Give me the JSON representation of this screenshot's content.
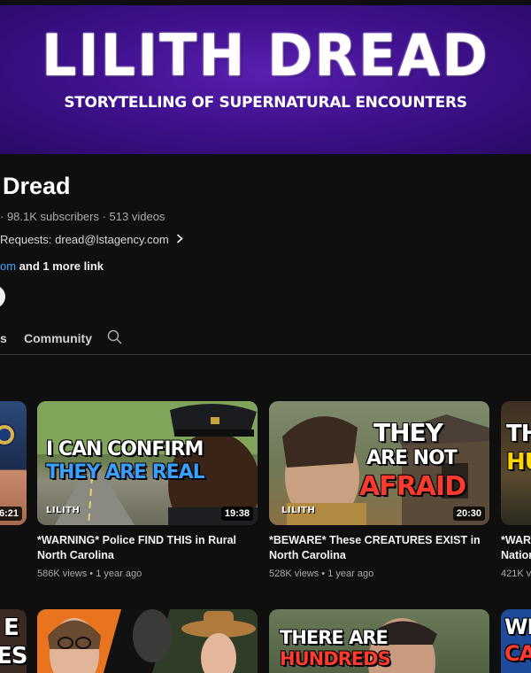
{
  "banner": {
    "title": "LILITH DREAD",
    "tagline": "STORYTELLING OF SUPERNATURAL ENCOUNTERS"
  },
  "channel": {
    "name": "Dread",
    "meta": "· 98.1K subscribers · 513 videos",
    "description": "Requests: dread@lstagency.com",
    "link_partial": "om",
    "more_links": " and 1 more link"
  },
  "tabs": {
    "partial": "s",
    "community": "Community"
  },
  "videos": [
    {
      "overlay_line1": "I CAN CONFIRM",
      "overlay_line2": "THEY ARE REAL",
      "brand": "LILITH",
      "duration": "19:38",
      "title": "*WARNING* Police FIND THIS in Rural North Carolina",
      "meta": "586K views • 1 year ago"
    },
    {
      "overlay_line1": "THEY",
      "overlay_line2": "ARE NOT",
      "overlay_line3": "AFRAID",
      "brand": "LILITH",
      "duration": "20:30",
      "title": "*BEWARE* These CREATURES EXIST in North Carolina",
      "meta": "528K views • 1 year ago"
    }
  ],
  "left_partial": {
    "duration": "6:21",
    "row2_text_line1": "E",
    "row2_text_line2": "ES"
  },
  "right_partial": {
    "overlay_line1": "TH",
    "overlay_line2": "HU",
    "title_line1": "*WARN",
    "title_line2": "Nation",
    "meta": "421K vi"
  },
  "row2": {
    "card2_line1": "THERE ARE",
    "card2_line2": "HUNDREDS",
    "right_text_line1": "WE",
    "right_text_line2": "CA"
  }
}
